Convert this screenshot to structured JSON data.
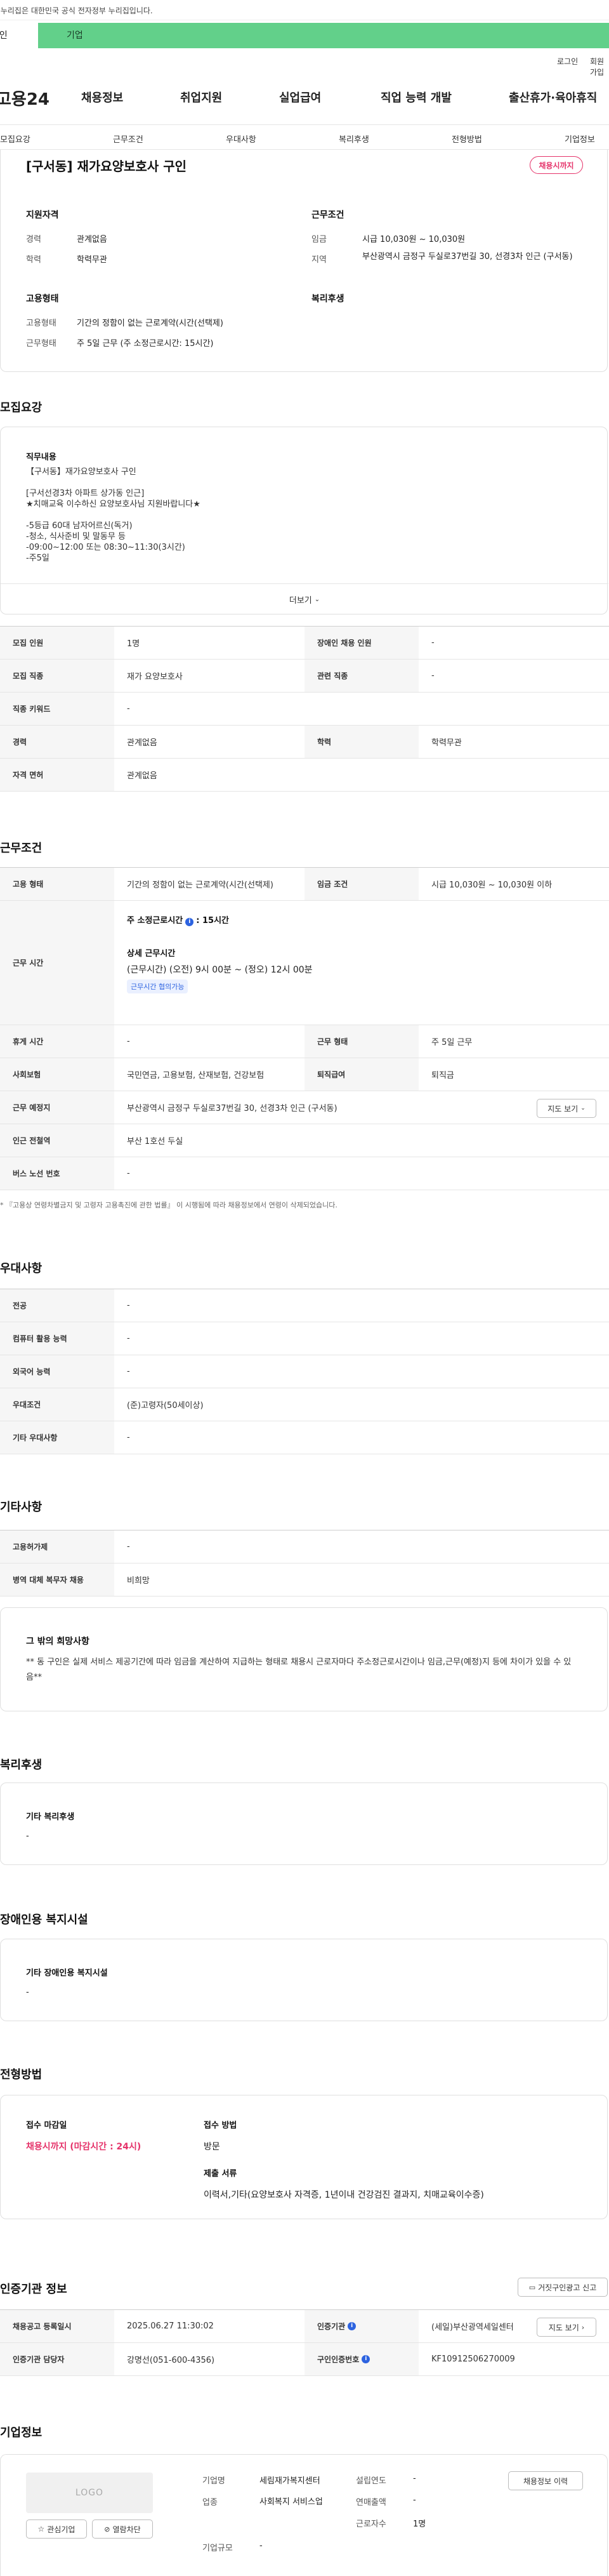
{
  "banner": {
    "text": "이 누리집은 대한민국 공식 전자정부 누리집입니다."
  },
  "tabs": {
    "a": "개인",
    "b": "기업"
  },
  "util": {
    "login": "로그인",
    "signup": "회원가입"
  },
  "gnb": {
    "logo": "고용24",
    "items": [
      "채용정보",
      "취업지원",
      "실업급여",
      "직업 능력 개발",
      "출산휴가·육아휴직"
    ]
  },
  "subnav": [
    "모집요강",
    "근무조건",
    "우대사항",
    "복리후생",
    "전형방법",
    "기업정보"
  ],
  "summary": {
    "title": "[구서동] 재가요양보호사 구인",
    "badge": "채용시까지",
    "qual_title": "지원자격",
    "career_label": "경력",
    "career_value": "관계없음",
    "edu_label": "학력",
    "edu_value": "학력무관",
    "cond_title": "근무조건",
    "wage_label": "임금",
    "wage_value": "시급 10,030원 ~ 10,030원",
    "region_label": "지역",
    "region_value": "부산광역시 금정구 두실로37번길 30, 선경3차 인근 (구서동)",
    "emp_title": "고용형태",
    "emptype_label": "고용형태",
    "emptype_value": "기간의 정함이 없는 근로계약(시간(선택제)",
    "workform_label": "근무형태",
    "workform_value": "주 5일 근무 (주 소정근로시간: 15시간)",
    "welfare_title": "복리후생"
  },
  "recruit": {
    "heading": "모집요강",
    "duty_title": "직무내용",
    "duty_text": "【구서동】재가요양보호사 구인\n\n[구서선경3차 아파트 상가동 인근]\n★치매교육 이수하신 요양보호사님 지원바랍니다★\n\n-5등급 60대 남자어르신(독거)\n-청소, 식사준비 및 말동무 등\n-09:00~12:00 또는 08:30~11:30(3시간)\n-주5일",
    "more": "더보기",
    "rows": [
      {
        "th": "모집 인원",
        "td": "1명",
        "th2": "장애인 채용 인원",
        "td2": "-"
      },
      {
        "th": "모집 직종",
        "td": "재가 요양보호사",
        "th2": "관련 직종",
        "td2": "-"
      },
      {
        "th": "직종 키워드",
        "td": "-"
      },
      {
        "th": "경력",
        "td": "관계없음",
        "th2": "학력",
        "td2": "학력무관"
      },
      {
        "th": "자격 면허",
        "td": "관계없음"
      }
    ]
  },
  "work": {
    "heading": "근무조건",
    "emptype_th": "고용 형태",
    "emptype_td": "기간의 정함이 없는 근로계약(시간(선택제)",
    "wage_th": "임금 조건",
    "wage_td": "시급 10,030원 ~ 10,030원 이하",
    "hours_th": "근무 시간",
    "hours_week_label": "주 소정근로시간",
    "hours_week_value": ": 15시간",
    "hours_detail_label": "상세 근무시간",
    "hours_detail_value": "(근무시간) (오전) 9시 00분 ~ (정오) 12시 00분",
    "hours_chip": "근무시간 협의가능",
    "rest_th": "휴게 시간",
    "rest_td": "-",
    "form_th": "근무 형태",
    "form_td": "주 5일 근무",
    "ins_th": "사회보험",
    "ins_td": "국민연금, 고용보험, 산재보험, 건강보험",
    "sev_th": "퇴직급여",
    "sev_td": "퇴직금",
    "place_th": "근무 예정지",
    "place_td": "부산광역시 금정구 두실로37번길 30, 선경3차 인근 (구서동)",
    "map_btn": "지도 보기",
    "subway_th": "인근 전철역",
    "subway_td": "부산 1호선 두실",
    "bus_th": "버스 노선 번호",
    "bus_td": "-",
    "note": "* 『고용상 연령차별금지 및 고령자 고용촉진에 관한 법률』 이 시행됨에 따라 채용정보에서 연령이 삭제되었습니다."
  },
  "pref": {
    "heading": "우대사항",
    "rows": [
      {
        "th": "전공",
        "td": "-"
      },
      {
        "th": "컴퓨터 활용 능력",
        "td": "-"
      },
      {
        "th": "외국어 능력",
        "td": "-"
      },
      {
        "th": "우대조건",
        "td": "(준)고령자(50세이상)"
      },
      {
        "th": "기타 우대사항",
        "td": "-"
      }
    ]
  },
  "etc": {
    "heading": "기타사항",
    "rows": [
      {
        "th": "고용허가제",
        "td": "-"
      },
      {
        "th": "병역 대체 복무자 채용",
        "td": "비희망"
      }
    ],
    "wish_title": "그 밖의 희망사항",
    "wish_text": "** 동 구인은 실제 서비스 제공기간에 따라 임금을 계산하여 지급하는 형태로 채용시 근로자마다 주소정근로시간이나 임금,근무(예정)지 등에 차이가 있을 수 있음**"
  },
  "welfare": {
    "heading": "복리후생",
    "sub": "기타 복리후생",
    "value": "-"
  },
  "disab": {
    "heading": "장애인용 복지시설",
    "sub": "기타 장애인용 복지시설",
    "value": "-"
  },
  "process": {
    "heading": "전형방법",
    "deadline_label": "접수 마감일",
    "deadline_value": "채용시까지 (마감시간 : 24시)",
    "method_label": "접수 방법",
    "method_value": "방문",
    "docs_label": "제출 서류",
    "docs_value": "이력서,기타(요양보호사 자격증, 1년이내 건강검진 결과지, 치매교육이수증)"
  },
  "cert": {
    "heading": "인증기관 정보",
    "report_btn": "거짓구인광고 신고",
    "reg_th": "채용공고 등록일시",
    "reg_td": "2025.06.27 11:30:02",
    "org_th": "인증기관",
    "org_td": "(세일)부산광역세일센터",
    "map_btn": "지도 보기",
    "mgr_th": "인증기관 담당자",
    "mgr_td": "강명선(051-600-4356)",
    "num_th": "구인인증번호",
    "num_td": "KF10912506270009"
  },
  "company": {
    "heading": "기업정보",
    "logo_text": "LOGO",
    "fav_btn": "관심기업",
    "block_btn": "열람차단",
    "name_label": "기업명",
    "name_value": "세림재가복지센터",
    "ind_label": "업종",
    "ind_value": "사회복지 서비스업",
    "size_label": "기업규모",
    "size_value": "-",
    "est_label": "설립연도",
    "est_value": "-",
    "sales_label": "연매출액",
    "sales_value": "-",
    "emp_label": "근로자수",
    "emp_value": "1명",
    "history_btn": "채용정보 이력"
  }
}
